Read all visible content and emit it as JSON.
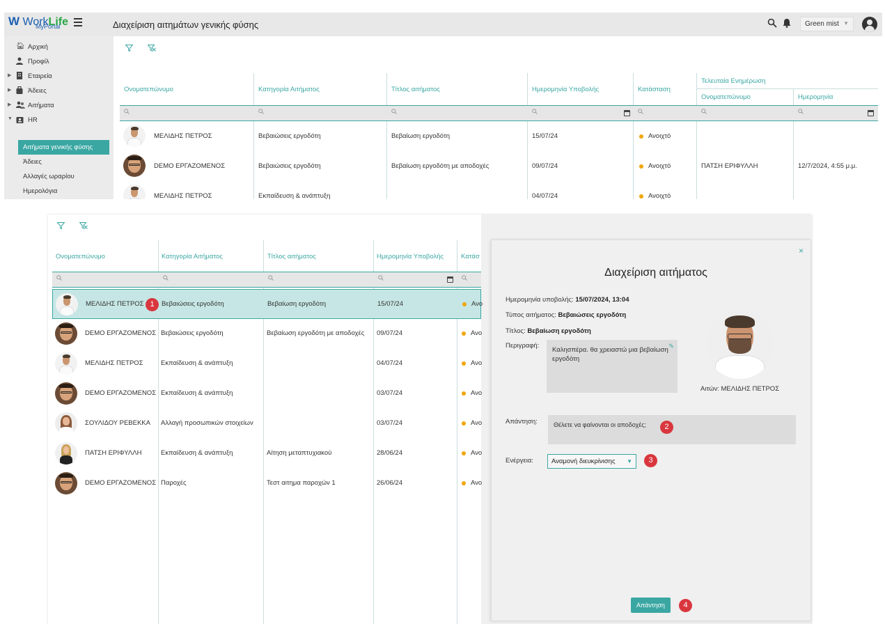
{
  "top": {
    "logo": {
      "brand_w": "W",
      "brand_work": "Work",
      "brand_life": "Life",
      "sub": "MyPortal"
    },
    "page_title": "Διαχείριση αιτημάτων γενικής φύσης",
    "theme_select": "Green mist",
    "sidebar": {
      "items": [
        {
          "label": "Αρχική"
        },
        {
          "label": "Προφίλ"
        },
        {
          "label": "Εταιρεία"
        },
        {
          "label": "Άδειες"
        },
        {
          "label": "Αιτήματα"
        },
        {
          "label": "HR"
        }
      ],
      "sub_items": [
        {
          "label": "Αιτήματα γενικής φύσης"
        },
        {
          "label": "Άδειες"
        },
        {
          "label": "Αλλαγές ωραρίου"
        },
        {
          "label": "Ημερολόγια"
        }
      ]
    },
    "grid": {
      "headers": {
        "name": "Ονοματεπώνυμο",
        "category": "Κατηγορία Αιτήματος",
        "title": "Τίτλος αιτήματος",
        "date": "Ημερομηνία Υποβολής",
        "status": "Κατάσταση",
        "last_update": "Τελευταία Ενημέρωση",
        "lu_name": "Ονοματεπώνυμο",
        "lu_date": "Ημερομηνία"
      },
      "search_glyph": "🔍",
      "rows": [
        {
          "name": "ΜΕΛΙΔΗΣ ΠΕΤΡΟΣ",
          "category": "Βεβαιώσεις εργοδότη",
          "title": "Βεβαίωση εργοδότη",
          "date": "15/07/24",
          "status": "Ανοιχτό",
          "lu_name": "",
          "lu_date": ""
        },
        {
          "name": "DEMO ΕΡΓΑΖΟΜΕΝΟΣ",
          "category": "Βεβαιώσεις εργοδότη",
          "title": "Βεβαίωση εργοδότη με αποδοχές",
          "date": "09/07/24",
          "status": "Ανοιχτό",
          "lu_name": "ΠΑΤΣΗ ΕΡΙΦΥΛΛΗ",
          "lu_date": "12/7/2024, 4:55 μ.μ."
        },
        {
          "name": "ΜΕΛΙΔΗΣ ΠΕΤΡΟΣ",
          "category": "Εκπαίδευση & ανάπτυξη",
          "title": "",
          "date": "04/07/24",
          "status": "Ανοιχτό",
          "lu_name": "",
          "lu_date": ""
        }
      ]
    }
  },
  "bottom": {
    "grid": {
      "headers": {
        "name": "Ονοματεπώνυμο",
        "category": "Κατηγορία Αιτήματος",
        "title": "Τίτλος αιτήματος",
        "date": "Ημερομηνία Υποβολής",
        "status": "Κατάσ"
      },
      "rows": [
        {
          "name": "ΜΕΛΙΔΗΣ ΠΕΤΡΟΣ",
          "category": "Βεβαιώσεις εργοδότη",
          "title": "Βεβαίωση εργοδότη",
          "date": "15/07/24",
          "status": "Ανο"
        },
        {
          "name": "DEMO ΕΡΓΑΖΟΜΕΝΟΣ",
          "category": "Βεβαιώσεις εργοδότη",
          "title": "Βεβαίωση εργοδότη με αποδοχές",
          "date": "09/07/24",
          "status": "Ανο"
        },
        {
          "name": "ΜΕΛΙΔΗΣ ΠΕΤΡΟΣ",
          "category": "Εκπαίδευση & ανάπτυξη",
          "title": "",
          "date": "04/07/24",
          "status": "Ανο"
        },
        {
          "name": "DEMO ΕΡΓΑΖΟΜΕΝΟΣ",
          "category": "Εκπαίδευση & ανάπτυξη",
          "title": "",
          "date": "03/07/24",
          "status": "Ανο"
        },
        {
          "name": "ΣΟΥΛΙΔΟΥ ΡΕΒΕΚΚΑ",
          "category": "Αλλαγή προσωπικών στοιχείων",
          "title": "",
          "date": "03/07/24",
          "status": "Ανο"
        },
        {
          "name": "ΠΑΤΣΗ ΕΡΙΦΥΛΛΗ",
          "category": "Εκπαίδευση & ανάπτυξη",
          "title": "Αίτηση μεταπτυχιακού",
          "date": "28/06/24",
          "status": "Ανο"
        },
        {
          "name": "DEMO ΕΡΓΑΖΟΜΕΝΟΣ",
          "category": "Παροχές",
          "title": "Τεστ αιτημα παροχών 1",
          "date": "26/06/24",
          "status": "Ανο"
        }
      ]
    },
    "panel": {
      "close": "×",
      "title": "Διαχείριση αιτήματος",
      "submit_date_label": "Ημερομηνία υποβολής:",
      "submit_date_value": "15/07/2024, 13:04",
      "type_label": "Τύπος αιτήματος:",
      "type_value": "Βεβαιώσεις εργοδότη",
      "title_label": "Τίτλος:",
      "title_value": "Βεβαίωση εργοδότη",
      "description_label": "Περιγραφή:",
      "description_value": "Καλησπέρα. θα χρειαστώ μια βεβαίωση εργοδότη",
      "requester": "Αιτών: ΜΕΛΙΔΗΣ ΠΕΤΡΟΣ",
      "reply_label": "Απάντηση:",
      "reply_value": "Θέλετε να φαίνονται οι αποδοχές;",
      "action_label": "Ενέργεια:",
      "action_value": "Αναμονή διευκρίνισης",
      "submit_button": "Απάντηση"
    },
    "markers": [
      "1",
      "2",
      "3",
      "4"
    ]
  },
  "colors": {
    "accent": "#3aa7a3",
    "marker": "#d9363e",
    "status_open": "#f0a500"
  }
}
